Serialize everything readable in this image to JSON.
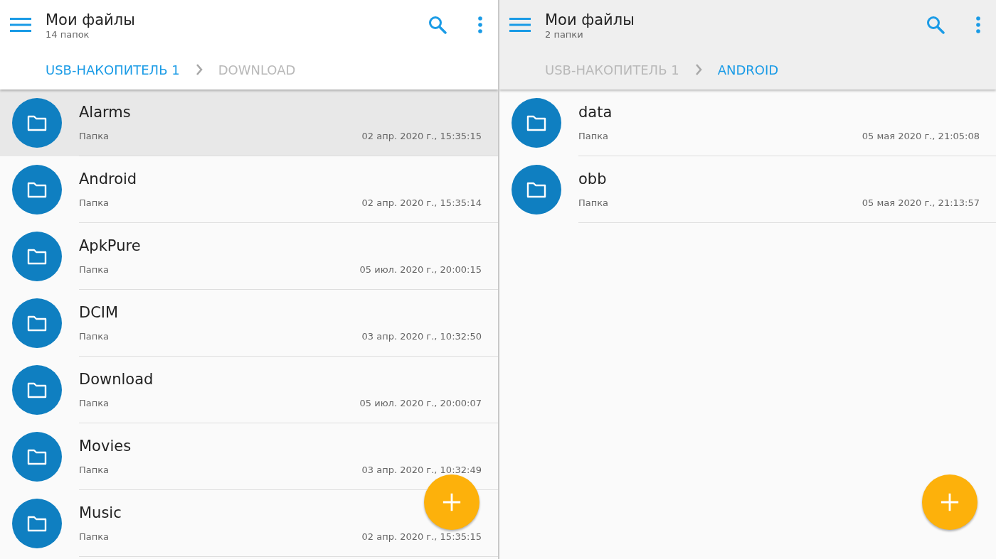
{
  "panes": [
    {
      "title": "Мои файлы",
      "subtitle": "14 папок",
      "active": true,
      "breadcrumbs": [
        {
          "label": "USB-НАКОПИТЕЛЬ 1",
          "selected": true
        },
        {
          "label": "DOWNLOAD",
          "selected": false
        }
      ],
      "items": [
        {
          "name": "Alarms",
          "type": "Папка",
          "date": "02 апр. 2020 г., 15:35:15",
          "selected": true
        },
        {
          "name": "Android",
          "type": "Папка",
          "date": "02 апр. 2020 г., 15:35:14",
          "selected": false
        },
        {
          "name": "ApkPure",
          "type": "Папка",
          "date": "05 июл. 2020 г., 20:00:15",
          "selected": false
        },
        {
          "name": "DCIM",
          "type": "Папка",
          "date": "03 апр. 2020 г., 10:32:50",
          "selected": false
        },
        {
          "name": "Download",
          "type": "Папка",
          "date": "05 июл. 2020 г., 20:00:07",
          "selected": false
        },
        {
          "name": "Movies",
          "type": "Папка",
          "date": "03 апр. 2020 г., 10:32:49",
          "selected": false
        },
        {
          "name": "Music",
          "type": "Папка",
          "date": "02 апр. 2020 г., 15:35:15",
          "selected": false
        }
      ]
    },
    {
      "title": "Мои файлы",
      "subtitle": "2 папки",
      "active": false,
      "breadcrumbs": [
        {
          "label": "USB-НАКОПИТЕЛЬ 1",
          "selected": false
        },
        {
          "label": "ANDROID",
          "selected": true
        }
      ],
      "items": [
        {
          "name": "data",
          "type": "Папка",
          "date": "05 мая 2020 г., 21:05:08",
          "selected": false
        },
        {
          "name": "obb",
          "type": "Папка",
          "date": "05 мая 2020 г., 21:13:57",
          "selected": false
        }
      ]
    }
  ]
}
